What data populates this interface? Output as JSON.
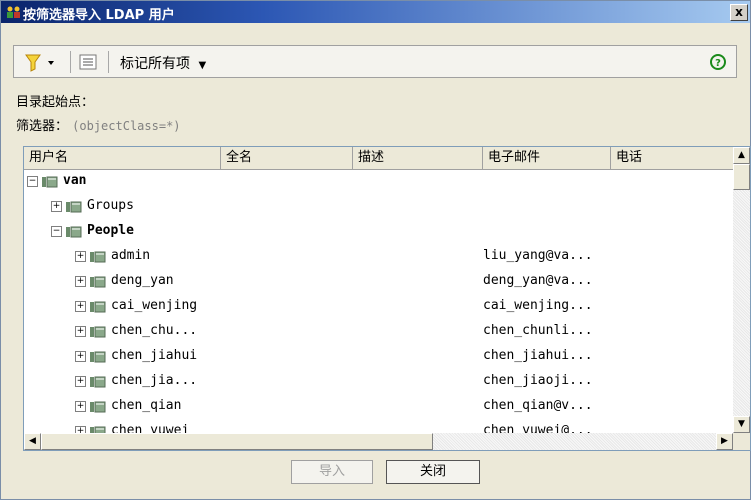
{
  "window": {
    "title": "按筛选器导入 LDAP 用户",
    "close_label": "x"
  },
  "toolbar": {
    "mark_all_label": "标记所有项"
  },
  "fields": {
    "root_label": "目录起始点：",
    "filter_label": "筛选器：",
    "filter_value": "(objectClass=*)"
  },
  "columns": [
    "用户名",
    "全名",
    "描述",
    "电子邮件",
    "电话"
  ],
  "tree": [
    {
      "name": "van",
      "email": "",
      "bold": true
    },
    {
      "name": "Groups",
      "email": "",
      "bold": false
    },
    {
      "name": "People",
      "email": "",
      "bold": true
    },
    {
      "name": "admin",
      "email": "liu_yang@va...",
      "bold": false
    },
    {
      "name": "deng_yan",
      "email": "deng_yan@va...",
      "bold": false
    },
    {
      "name": "cai_wenjing",
      "email": "cai_wenjing...",
      "bold": false
    },
    {
      "name": "chen_chu...",
      "email": "chen_chunli...",
      "bold": false
    },
    {
      "name": "chen_jiahui",
      "email": "chen_jiahui...",
      "bold": false
    },
    {
      "name": "chen_jia...",
      "email": "chen_jiaoji...",
      "bold": false
    },
    {
      "name": "chen_qian",
      "email": "chen_qian@v...",
      "bold": false
    },
    {
      "name": "chen_yuwei",
      "email": "chen_yuwei@...",
      "bold": false
    }
  ],
  "buttons": {
    "import_label": "导入",
    "close_label": "关闭"
  },
  "colors": {
    "titlebar_start": "#0a246a",
    "titlebar_end": "#a6caf0",
    "help_icon": "#1a8a1a"
  }
}
